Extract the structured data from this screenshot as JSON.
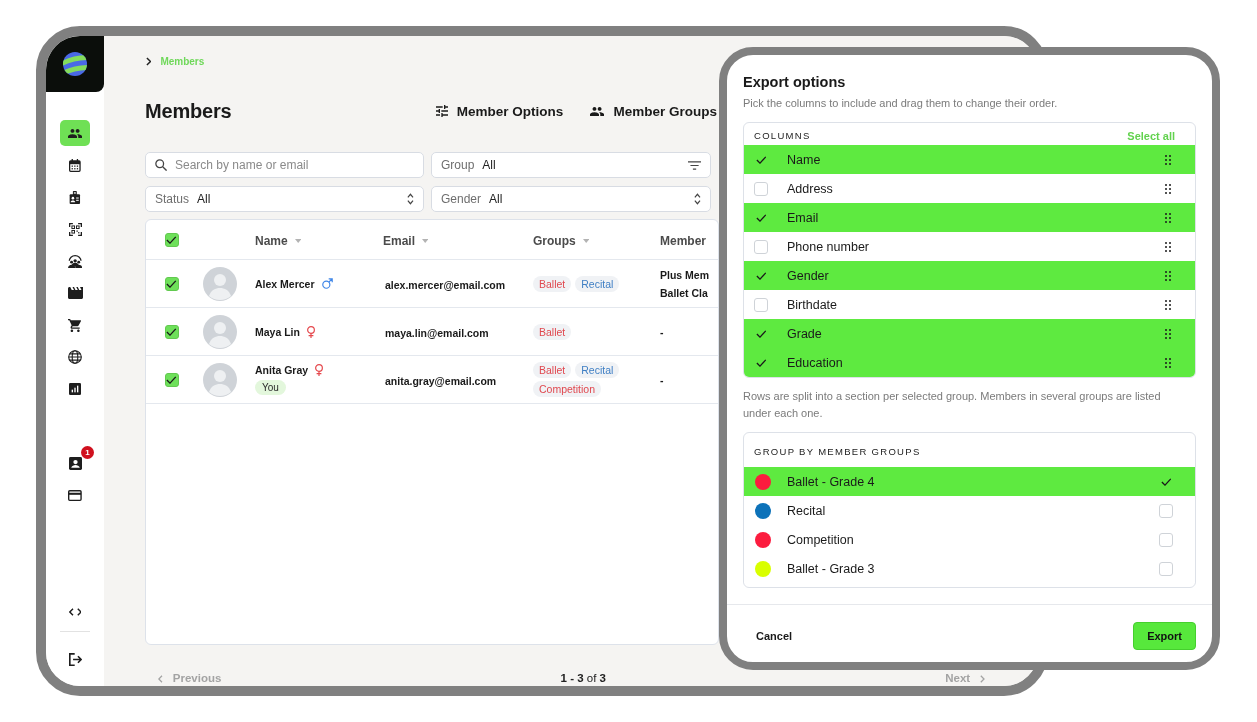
{
  "sidebar": {
    "nav_items": [
      {
        "selected": true
      },
      {
        "selected": false
      },
      {
        "selected": false
      },
      {
        "selected": false
      },
      {
        "selected": false
      },
      {
        "selected": false
      },
      {
        "selected": false
      },
      {
        "selected": false
      },
      {
        "selected": false
      }
    ],
    "account_items": [
      {
        "selected": false,
        "badge": "1"
      },
      {
        "selected": false
      }
    ]
  },
  "breadcrumb": [
    "Members"
  ],
  "page_title": "Members",
  "header_actions": [
    {
      "kind": "options",
      "label": "Member Options"
    },
    {
      "kind": "groups",
      "label": "Member Groups"
    }
  ],
  "filters": [
    {
      "kind": "search",
      "placeholder": "Search by name or email"
    },
    {
      "kind": "filter",
      "label": "Group",
      "value": "All"
    },
    {
      "kind": "select",
      "label": "Status",
      "value": "All"
    },
    {
      "kind": "select",
      "label": "Gender",
      "value": "All"
    }
  ],
  "table": {
    "all_checked": true,
    "columns": [
      {
        "label": "Name",
        "sort_caret": true
      },
      {
        "label": "Email",
        "sort_caret": true
      },
      {
        "label": "Groups",
        "sort_caret": true
      },
      {
        "label": "Member",
        "sort_caret": false
      }
    ],
    "rows": [
      {
        "checked": true,
        "name": "Alex Mercer",
        "gender_symbol": {
          "kind": "male"
        },
        "email": "alex.mercer@email.com",
        "groups": [
          {
            "label": "Ballet",
            "color": "#e0484f"
          },
          {
            "label": "Recital",
            "color": "#3f7fc4"
          }
        ],
        "member": [
          "Plus Mem",
          "Ballet Cla"
        ]
      },
      {
        "checked": true,
        "name": "Maya Lin",
        "gender_symbol": {
          "kind": "female"
        },
        "email": "maya.lin@email.com",
        "groups": [
          {
            "label": "Ballet",
            "color": "#e0484f"
          }
        ],
        "member": [
          "-"
        ]
      },
      {
        "checked": true,
        "name": "Anita Gray",
        "gender_symbol": {
          "kind": "female"
        },
        "badge": "You",
        "email": "anita.gray@email.com",
        "groups": [
          {
            "label": "Ballet",
            "color": "#e0484f"
          },
          {
            "label": "Recital",
            "color": "#3f7fc4"
          },
          {
            "label": "Competition",
            "color": "#e0484f"
          }
        ],
        "member": [
          "-"
        ]
      }
    ]
  },
  "pagination": {
    "previous": {
      "label": "Previous",
      "disabled": true
    },
    "range": "**1 - 3** of **3**",
    "next": {
      "label": "Next",
      "disabled": true
    }
  },
  "export_dialog": {
    "title": "Export options",
    "subtitle": "Pick the columns to include and drag them to change their order.",
    "columns_panel": {
      "heading": "COLUMNS",
      "select_all": "Select all",
      "items": [
        {
          "label": "Name",
          "checked": true
        },
        {
          "label": "Address",
          "checked": false
        },
        {
          "label": "Email",
          "checked": true
        },
        {
          "label": "Phone number",
          "checked": false
        },
        {
          "label": "Gender",
          "checked": true
        },
        {
          "label": "Birthdate",
          "checked": false
        },
        {
          "label": "Grade",
          "checked": true
        },
        {
          "label": "Education",
          "checked": true
        }
      ]
    },
    "note": "Rows are split into a section per selected group. Members in several groups are listed under each one.",
    "groups_panel": {
      "heading": "GROUP BY MEMBER GROUPS",
      "items": [
        {
          "label": "Ballet - Grade 4",
          "color": "#fc1c3e",
          "selected": true
        },
        {
          "label": "Recital",
          "color": "#0d72b9",
          "selected": false
        },
        {
          "label": "Competition",
          "color": "#fc1c3e",
          "selected": false
        },
        {
          "label": "Ballet - Grade 3",
          "color": "#d9ff00",
          "selected": false
        }
      ]
    },
    "cancel": "Cancel",
    "export": "Export"
  }
}
